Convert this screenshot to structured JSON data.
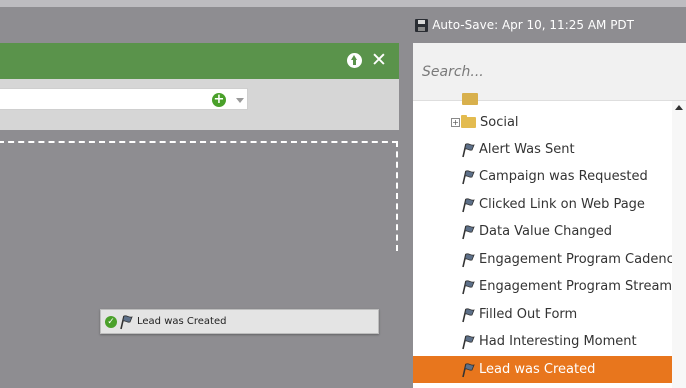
{
  "status": {
    "autosave_text": "Auto-Save: Apr 10, 11:25 AM PDT"
  },
  "panel": {
    "collapse_icon": "arrow-up-circle-icon",
    "close_icon": "close-icon",
    "close_glyph": "✕",
    "add_glyph": "+",
    "check_glyph": "✓"
  },
  "canvas": {
    "dropped_trigger_label": "Lead was Created"
  },
  "sidebar": {
    "search_placeholder": "Search...",
    "folder_label": "Social",
    "expand_glyph": "+",
    "items": [
      {
        "label": "Alert Was Sent"
      },
      {
        "label": "Campaign was Requested"
      },
      {
        "label": "Clicked Link on Web Page"
      },
      {
        "label": "Data Value Changed"
      },
      {
        "label": "Engagement Program Cadence C"
      },
      {
        "label": "Engagement Program Stream Ch"
      },
      {
        "label": "Filled Out Form"
      },
      {
        "label": "Had Interesting Moment"
      },
      {
        "label": "Lead was Created",
        "selected": true
      }
    ]
  },
  "colors": {
    "panel_header": "#5a934b",
    "selected_row": "#e8761d",
    "background": "#8e8d91"
  }
}
